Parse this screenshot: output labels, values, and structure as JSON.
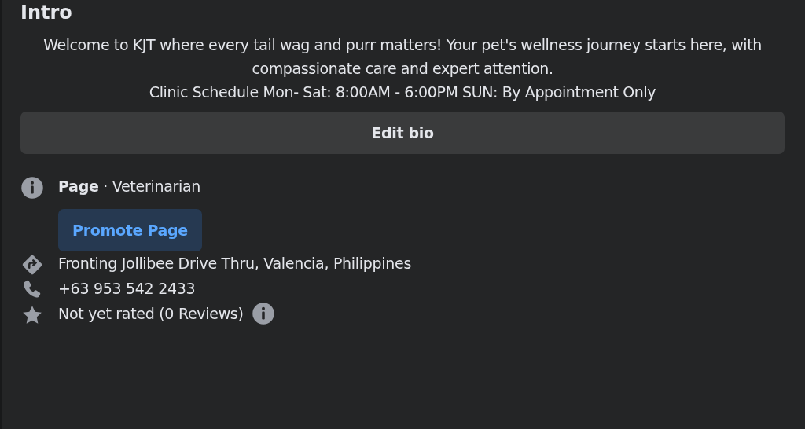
{
  "title": "Intro",
  "bio": [
    "Welcome to KJT where every tail wag and purr matters! Your pet's wellness journey starts here, with compassionate care and expert attention.",
    "Clinic Schedule Mon- Sat: 8:00AM - 6:00PM SUN: By Appointment Only"
  ],
  "edit_button": "Edit bio",
  "details": [
    {
      "kind": "category",
      "text": "**Page** · Veterinarian",
      "button": "Promote Page"
    },
    {
      "kind": "address",
      "text": "Fronting Jollibee Drive Thru, Valencia, Philippines"
    },
    {
      "kind": "phone",
      "text": "+63 953 542 2433"
    },
    {
      "kind": "rating",
      "text": "Not yet rated (0 Reviews)"
    }
  ]
}
